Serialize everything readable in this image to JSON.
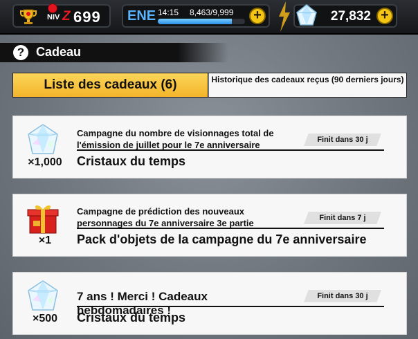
{
  "statusbar": {
    "level_prefix": "NIV",
    "level_z": "Z",
    "level": "699",
    "energy_label": "ENE",
    "energy_timer": "14:15",
    "energy_count": "8,463/9,999",
    "energy_fill_fraction": 0.846,
    "currency": "27,832"
  },
  "header": {
    "title": "Cadeau",
    "help_icon": "?"
  },
  "tabs": {
    "active": "Liste des cadeaux (6)",
    "history": "Historique des cadeaux reçus (90 derniers jours)"
  },
  "gifts": [
    {
      "campaign": "Campagne du nombre de visionnages total de l'émission de juillet pour le 7e anniversaire",
      "expiry": "Finit dans 30 j",
      "reward": "Cristaux du temps",
      "quantity": "×1,000",
      "icon": "time-crystal-icon"
    },
    {
      "campaign": "Campagne de prédiction des nouveaux personnages du 7e anniversaire 3e partie",
      "expiry": "Finit dans 7 j",
      "reward": "Pack d'objets de la campagne du 7e anniversaire",
      "quantity": "×1",
      "icon": "gift-box-icon"
    },
    {
      "campaign": "7 ans ! Merci ! Cadeaux hebdomadaires !",
      "expiry": "Finit dans 30 j",
      "reward": "Cristaux du temps",
      "quantity": "×500",
      "icon": "time-crystal-icon"
    }
  ],
  "colors": {
    "accent_yellow": "#f3b52a",
    "energy_blue": "#5ab3ff",
    "level_red": "#e31b22"
  }
}
